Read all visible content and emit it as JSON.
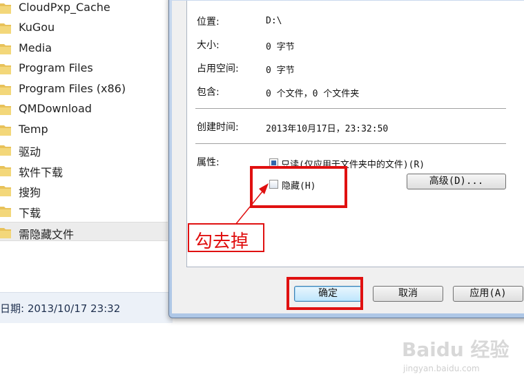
{
  "explorer": {
    "folders": [
      {
        "label": "CloudPxp_Cache"
      },
      {
        "label": "KuGou"
      },
      {
        "label": "Media"
      },
      {
        "label": "Program Files"
      },
      {
        "label": "Program Files (x86)"
      },
      {
        "label": "QMDownload"
      },
      {
        "label": "Temp"
      },
      {
        "label": "驱动"
      },
      {
        "label": "软件下载"
      },
      {
        "label": "搜狗"
      },
      {
        "label": "下载"
      },
      {
        "label": "需隐藏文件"
      }
    ],
    "selected_index": 11,
    "status_text": "日期: 2013/10/17 23:32"
  },
  "dialog": {
    "rows": [
      {
        "label": "位置:",
        "value": "D:\\"
      },
      {
        "label": "大小:",
        "value": "0 字节"
      },
      {
        "label": "占用空间:",
        "value": "0 字节"
      },
      {
        "label": "包含:",
        "value": "0 个文件，0 个文件夹"
      }
    ],
    "created": {
      "label": "创建时间:",
      "value": "2013年10月17日，23:32:50"
    },
    "attributes": {
      "label": "属性:",
      "readonly_label": "只读(仅应用于文件夹中的文件)(R)",
      "readonly_state": "indeterminate",
      "hidden_label": "隐藏(H)",
      "hidden_checked": false,
      "advanced_button": "高级(D)..."
    },
    "buttons": {
      "ok": "确定",
      "cancel": "取消",
      "apply": "应用(A)"
    }
  },
  "annotation": {
    "text": "勾去掉",
    "color": "#e01010"
  },
  "watermark": {
    "logo": "Baidu 经验",
    "url": "jingyan.baidu.com"
  }
}
